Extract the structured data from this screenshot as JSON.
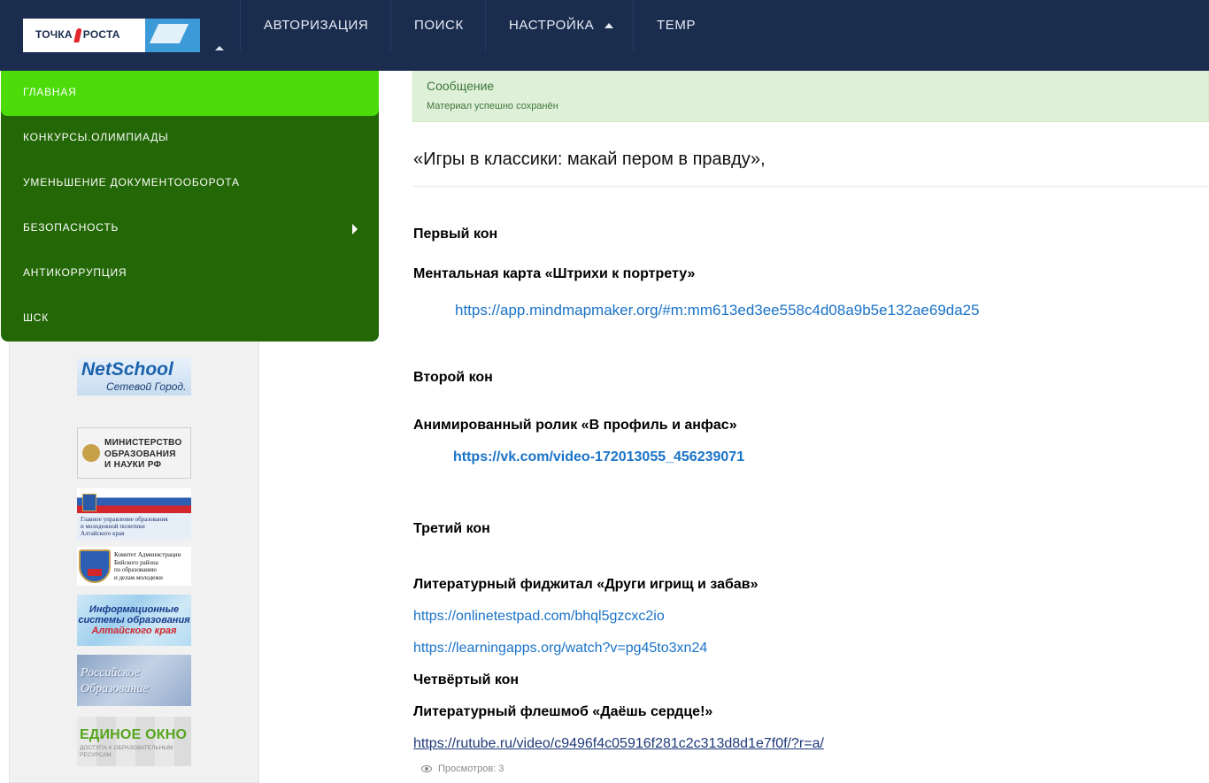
{
  "header": {
    "logo_text_left": "ТОЧКА",
    "logo_text_right": "РОСТА",
    "nav": [
      {
        "label": "АВТОРИЗАЦИЯ"
      },
      {
        "label": "ПОИСК"
      },
      {
        "label": "НАСТРОЙКА"
      },
      {
        "label": "TEMP"
      }
    ]
  },
  "side_menu": {
    "items": [
      {
        "label": "ГЛАВНАЯ",
        "active": true
      },
      {
        "label": "КОНКУРСЫ.ОЛИМПИАДЫ"
      },
      {
        "label": "УМЕНЬШЕНИЕ ДОКУМЕНТООБОРОТА"
      },
      {
        "label": "БЕЗОПАСНОСТЬ",
        "has_submenu": true
      },
      {
        "label": "АНТИКОРРУПЦИЯ"
      },
      {
        "label": "ШСК"
      }
    ]
  },
  "banners": {
    "netschool": {
      "title": "NetSchool",
      "subtitle": "Сетевой Город."
    },
    "minobr": {
      "text": "МИНИСТЕРСТВО\nОБРАЗОВАНИЯ\nИ НАУКИ РФ"
    },
    "glavupr": {
      "text": "Главное управление образования\nи молодежной политики\nАлтайского края"
    },
    "biysk": {
      "text": "Комитет Администрации\nБийского района\nпо образованию\nи делам молодежи"
    },
    "infosys": {
      "line1": "Информационные",
      "line2": "системы образования",
      "line3": "Алтайского края"
    },
    "rosobr": {
      "text": "Российское\nОбразование"
    },
    "edinoe": {
      "title": "ЕДИНОЕ ОКНО",
      "subtitle": "ДОСТУПА К ОБРАЗОВАТЕЛЬНЫМ\nРЕСУРСАМ"
    }
  },
  "colors": {
    "navbar": "#1b2d4f",
    "menu_bg": "#236706",
    "menu_active": "#4ddb0a",
    "alert_bg": "#dff0d8",
    "link": "#1a73c8"
  },
  "alert": {
    "title": "Сообщение",
    "text": "Материал успешно сохранён"
  },
  "article": {
    "title": "«Игры в классики: макай пером в правду»,",
    "round1": "Первый кон",
    "round1_task": "Ментальная карта «Штрихи к портрету»",
    "round1_link": "https://app.mindmapmaker.org/#m:mm613ed3ee558c4d08a9b5e132ae69da25",
    "round2": "Второй кон",
    "round2_task": "Анимированный ролик «В профиль и анфас»",
    "round2_link": "https://vk.com/video-172013055_456239071",
    "round3": "Третий кон",
    "round3_task": "Литературный фиджитал «Други игрищ и забав»",
    "round3_link1": "https://onlinetestpad.com/bhql5gzcxc2io",
    "round3_link2": "https://learningapps.org/watch?v=pg45to3xn24",
    "round4": "Четвёртый кон",
    "round4_task": "Литературный флешмоб «Даёшь сердце!»",
    "round4_link": "https://rutube.ru/video/c9496f4c05916f281c2c313d8d1e7f0f/?r=a/",
    "views": "Просмотров: 3"
  }
}
